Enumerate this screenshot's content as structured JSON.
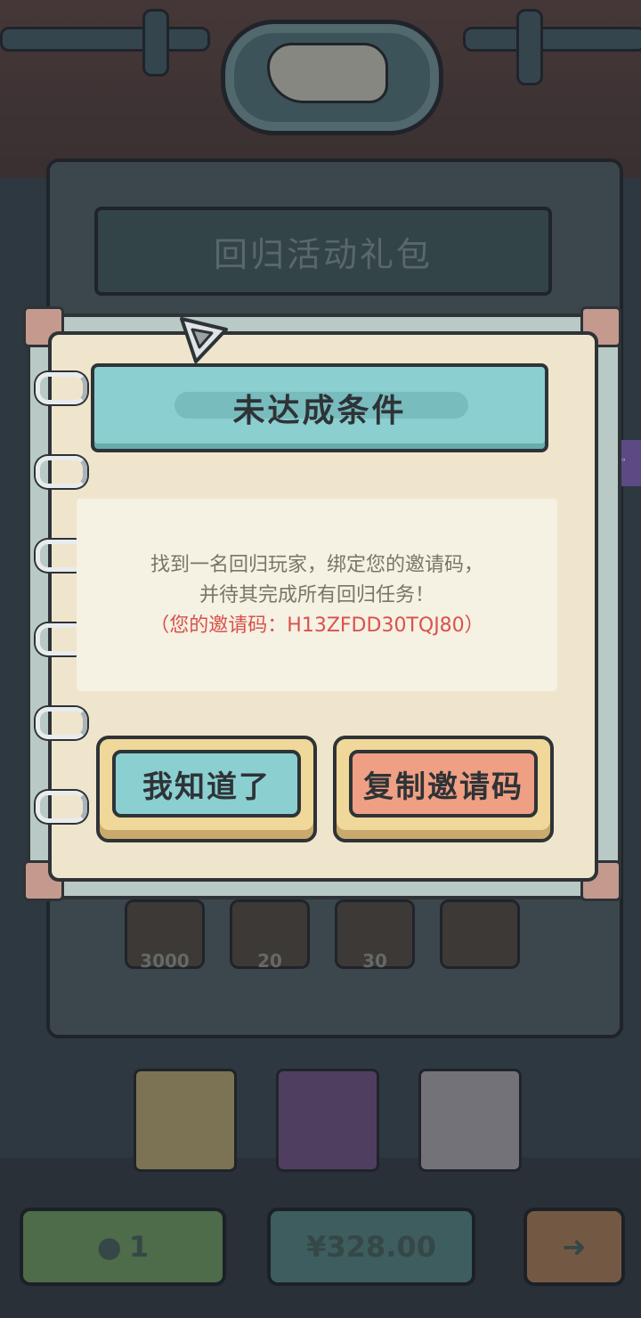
{
  "background": {
    "panel_title": "回归活动礼包",
    "rewards": [
      {
        "icon": "ghost-icon",
        "count": "3000"
      },
      {
        "icon": "ticket-icon",
        "count": "20"
      },
      {
        "icon": "orb-icon",
        "count": "30"
      },
      {
        "icon": "ring-icon",
        "count": ""
      }
    ],
    "bottom_bar": {
      "ghost_count": "1",
      "price": "¥328.00",
      "next_icon": "arrow-right-icon"
    }
  },
  "dialog": {
    "title": "未达成条件",
    "message_line1": "找到一名回归玩家，绑定您的邀请码，",
    "message_line2": "并待其完成所有回归任务！",
    "invite_code_line": "（您的邀请码：H13ZFDD30TQJ80）",
    "ok_label": "我知道了",
    "copy_label": "复制邀请码"
  },
  "colors": {
    "accent_teal": "#8ccfd0",
    "accent_orange": "#ef9f83",
    "code_red": "#d9524b",
    "paper": "#efe5cc"
  }
}
